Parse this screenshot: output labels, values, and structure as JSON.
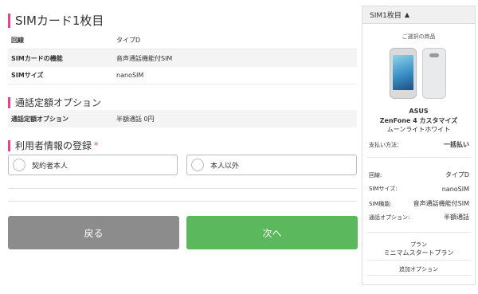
{
  "sim_section": {
    "title": "SIMカード1枚目",
    "rows": [
      {
        "label": "回線",
        "value": "タイプD"
      },
      {
        "label": "SIMカードの機能",
        "value": "音声通話機能付SIM"
      },
      {
        "label": "SIMサイズ",
        "value": "nanoSIM"
      }
    ]
  },
  "call_option": {
    "title": "通話定額オプション",
    "row": {
      "label": "通話定額オプション",
      "value": "半額通話 0円"
    }
  },
  "user_info": {
    "title": "利用者情報の登録",
    "required_mark": "*",
    "options": [
      "契約者本人",
      "本人以外"
    ]
  },
  "buttons": {
    "back": "戻る",
    "next": "次へ"
  },
  "sidebar": {
    "header": "SIM1枚目",
    "header_icon": "chevron-up-icon",
    "selected_label": "ご選択の商品",
    "brand": "ASUS",
    "model": "ZenFone 4 カスタマイズ",
    "color": "ムーンライトホワイト",
    "payment": {
      "label": "支払い方法：",
      "value": "一括払い"
    },
    "details": [
      {
        "label": "回線:",
        "value": "タイプD"
      },
      {
        "label": "SIMサイズ:",
        "value": "nanoSIM"
      },
      {
        "label": "SIM機能:",
        "value": "音声通話機能付SIM"
      },
      {
        "label": "通話オプション:",
        "value": "半額通話"
      }
    ],
    "plan_label": "プラン",
    "plan_value": "ミニマムスタートプラン",
    "addon_label": "追加オプション"
  },
  "colors": {
    "accent": "#e8418d",
    "next_button": "#5cb85c",
    "back_button": "#8c8c8c"
  }
}
